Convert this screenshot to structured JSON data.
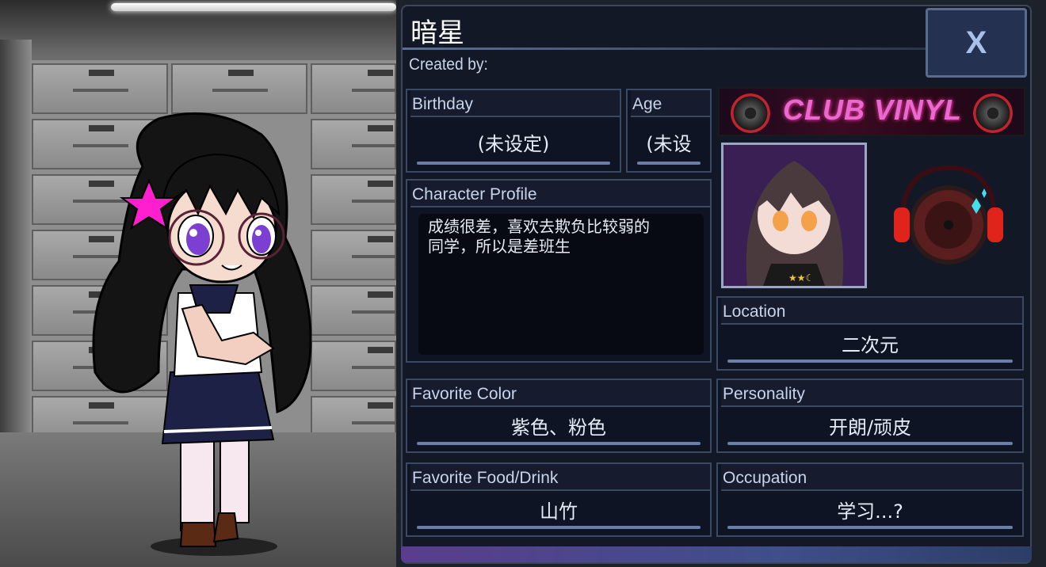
{
  "header": {
    "character_name": "暗星",
    "created_by_label": "Created by:",
    "close_label": "X"
  },
  "fields": {
    "birthday": {
      "label": "Birthday",
      "value": "(未设定)"
    },
    "age": {
      "label": "Age",
      "value": "(未设"
    },
    "profile": {
      "label": "Character Profile",
      "value": "成绩很差，喜欢去欺负比较弱的\n同学，所以是差班生"
    },
    "location": {
      "label": "Location",
      "value": "二次元"
    },
    "favorite_color": {
      "label": "Favorite Color",
      "value": "紫色、粉色"
    },
    "personality": {
      "label": "Personality",
      "value": "开朗/顽皮"
    },
    "favorite_food": {
      "label": "Favorite Food/Drink",
      "value": "山竹"
    },
    "occupation": {
      "label": "Occupation",
      "value": "学习...?"
    }
  },
  "banner": {
    "text": "CLUB VINYL"
  },
  "icons": {
    "close": "close-icon",
    "portrait": "character-portrait",
    "emblem": "headphones-vinyl-icon"
  },
  "colors": {
    "panel_bg": "#121826",
    "field_border": "#3c4963",
    "label_text": "#c8d4ea",
    "accent_pink": "#e86ad0",
    "close_bg": "#243150"
  }
}
